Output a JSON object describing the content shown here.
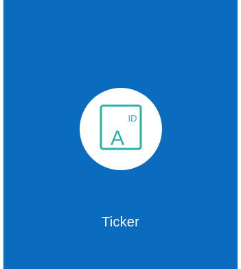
{
  "tile": {
    "label": "Ticker",
    "icon": {
      "name": "ticker-id-icon",
      "main_glyph": "A",
      "superscript": "ID"
    }
  },
  "colors": {
    "tile_background": "#0b6bbf",
    "icon_circle": "#ffffff",
    "icon_stroke": "#2cb0a6",
    "label_text": "#ffffff"
  }
}
